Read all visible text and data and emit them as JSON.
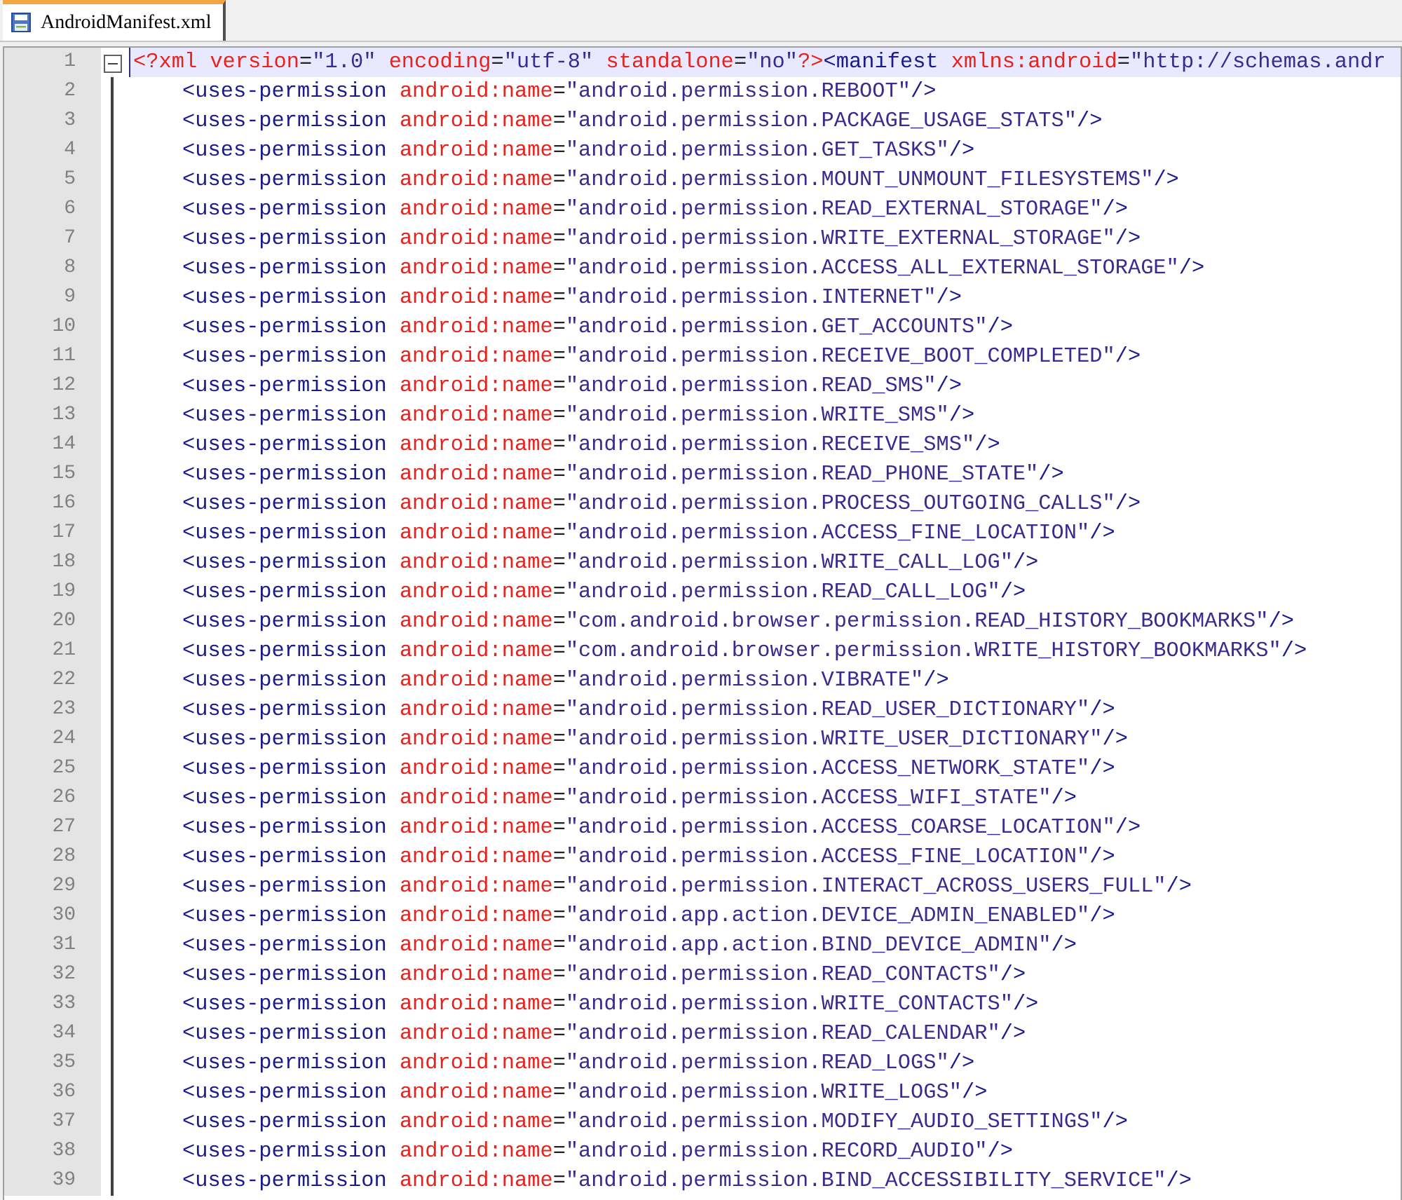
{
  "tabs": [
    {
      "label": "AndroidManifest.xml",
      "selected": true
    }
  ],
  "editor": {
    "root": {
      "number": "1",
      "current": true,
      "expanded": true,
      "tokens": [
        {
          "kind": "attr",
          "text": "<?xml"
        },
        {
          "kind": "attr",
          "text": " version"
        },
        {
          "kind": "punct",
          "text": "="
        },
        {
          "kind": "value",
          "text": "\"1.0\""
        },
        {
          "kind": "attr",
          "text": " encoding"
        },
        {
          "kind": "punct",
          "text": "="
        },
        {
          "kind": "value",
          "text": "\"utf-8\""
        },
        {
          "kind": "attr",
          "text": " standalone"
        },
        {
          "kind": "punct",
          "text": "="
        },
        {
          "kind": "value",
          "text": "\"no\""
        },
        {
          "kind": "attr",
          "text": "?>"
        },
        {
          "kind": "tag",
          "text": "<manifest"
        },
        {
          "kind": "attr",
          "text": " xmlns:android"
        },
        {
          "kind": "punct",
          "text": "="
        },
        {
          "kind": "value",
          "text": "\"http://schemas.andr"
        }
      ],
      "children": [
        {
          "number": "2",
          "current": false,
          "tokens": [
            {
              "kind": "tag",
              "text": "<uses-permission"
            },
            {
              "kind": "attr",
              "text": " android:name"
            },
            {
              "kind": "punct",
              "text": "="
            },
            {
              "kind": "value",
              "text": "\"android.permission.REBOOT\""
            },
            {
              "kind": "tag",
              "text": "/>"
            }
          ]
        },
        {
          "number": "3",
          "current": false,
          "tokens": [
            {
              "kind": "tag",
              "text": "<uses-permission"
            },
            {
              "kind": "attr",
              "text": " android:name"
            },
            {
              "kind": "punct",
              "text": "="
            },
            {
              "kind": "value",
              "text": "\"android.permission.PACKAGE_USAGE_STATS\""
            },
            {
              "kind": "tag",
              "text": "/>"
            }
          ]
        },
        {
          "number": "4",
          "current": false,
          "tokens": [
            {
              "kind": "tag",
              "text": "<uses-permission"
            },
            {
              "kind": "attr",
              "text": " android:name"
            },
            {
              "kind": "punct",
              "text": "="
            },
            {
              "kind": "value",
              "text": "\"android.permission.GET_TASKS\""
            },
            {
              "kind": "tag",
              "text": "/>"
            }
          ]
        },
        {
          "number": "5",
          "current": false,
          "tokens": [
            {
              "kind": "tag",
              "text": "<uses-permission"
            },
            {
              "kind": "attr",
              "text": " android:name"
            },
            {
              "kind": "punct",
              "text": "="
            },
            {
              "kind": "value",
              "text": "\"android.permission.MOUNT_UNMOUNT_FILESYSTEMS\""
            },
            {
              "kind": "tag",
              "text": "/>"
            }
          ]
        },
        {
          "number": "6",
          "current": false,
          "tokens": [
            {
              "kind": "tag",
              "text": "<uses-permission"
            },
            {
              "kind": "attr",
              "text": " android:name"
            },
            {
              "kind": "punct",
              "text": "="
            },
            {
              "kind": "value",
              "text": "\"android.permission.READ_EXTERNAL_STORAGE\""
            },
            {
              "kind": "tag",
              "text": "/>"
            }
          ]
        },
        {
          "number": "7",
          "current": false,
          "tokens": [
            {
              "kind": "tag",
              "text": "<uses-permission"
            },
            {
              "kind": "attr",
              "text": " android:name"
            },
            {
              "kind": "punct",
              "text": "="
            },
            {
              "kind": "value",
              "text": "\"android.permission.WRITE_EXTERNAL_STORAGE\""
            },
            {
              "kind": "tag",
              "text": "/>"
            }
          ]
        },
        {
          "number": "8",
          "current": false,
          "tokens": [
            {
              "kind": "tag",
              "text": "<uses-permission"
            },
            {
              "kind": "attr",
              "text": " android:name"
            },
            {
              "kind": "punct",
              "text": "="
            },
            {
              "kind": "value",
              "text": "\"android.permission.ACCESS_ALL_EXTERNAL_STORAGE\""
            },
            {
              "kind": "tag",
              "text": "/>"
            }
          ]
        },
        {
          "number": "9",
          "current": false,
          "tokens": [
            {
              "kind": "tag",
              "text": "<uses-permission"
            },
            {
              "kind": "attr",
              "text": " android:name"
            },
            {
              "kind": "punct",
              "text": "="
            },
            {
              "kind": "value",
              "text": "\"android.permission.INTERNET\""
            },
            {
              "kind": "tag",
              "text": "/>"
            }
          ]
        },
        {
          "number": "10",
          "current": false,
          "tokens": [
            {
              "kind": "tag",
              "text": "<uses-permission"
            },
            {
              "kind": "attr",
              "text": " android:name"
            },
            {
              "kind": "punct",
              "text": "="
            },
            {
              "kind": "value",
              "text": "\"android.permission.GET_ACCOUNTS\""
            },
            {
              "kind": "tag",
              "text": "/>"
            }
          ]
        },
        {
          "number": "11",
          "current": false,
          "tokens": [
            {
              "kind": "tag",
              "text": "<uses-permission"
            },
            {
              "kind": "attr",
              "text": " android:name"
            },
            {
              "kind": "punct",
              "text": "="
            },
            {
              "kind": "value",
              "text": "\"android.permission.RECEIVE_BOOT_COMPLETED\""
            },
            {
              "kind": "tag",
              "text": "/>"
            }
          ]
        },
        {
          "number": "12",
          "current": false,
          "tokens": [
            {
              "kind": "tag",
              "text": "<uses-permission"
            },
            {
              "kind": "attr",
              "text": " android:name"
            },
            {
              "kind": "punct",
              "text": "="
            },
            {
              "kind": "value",
              "text": "\"android.permission.READ_SMS\""
            },
            {
              "kind": "tag",
              "text": "/>"
            }
          ]
        },
        {
          "number": "13",
          "current": false,
          "tokens": [
            {
              "kind": "tag",
              "text": "<uses-permission"
            },
            {
              "kind": "attr",
              "text": " android:name"
            },
            {
              "kind": "punct",
              "text": "="
            },
            {
              "kind": "value",
              "text": "\"android.permission.WRITE_SMS\""
            },
            {
              "kind": "tag",
              "text": "/>"
            }
          ]
        },
        {
          "number": "14",
          "current": false,
          "tokens": [
            {
              "kind": "tag",
              "text": "<uses-permission"
            },
            {
              "kind": "attr",
              "text": " android:name"
            },
            {
              "kind": "punct",
              "text": "="
            },
            {
              "kind": "value",
              "text": "\"android.permission.RECEIVE_SMS\""
            },
            {
              "kind": "tag",
              "text": "/>"
            }
          ]
        },
        {
          "number": "15",
          "current": false,
          "tokens": [
            {
              "kind": "tag",
              "text": "<uses-permission"
            },
            {
              "kind": "attr",
              "text": " android:name"
            },
            {
              "kind": "punct",
              "text": "="
            },
            {
              "kind": "value",
              "text": "\"android.permission.READ_PHONE_STATE\""
            },
            {
              "kind": "tag",
              "text": "/>"
            }
          ]
        },
        {
          "number": "16",
          "current": false,
          "tokens": [
            {
              "kind": "tag",
              "text": "<uses-permission"
            },
            {
              "kind": "attr",
              "text": " android:name"
            },
            {
              "kind": "punct",
              "text": "="
            },
            {
              "kind": "value",
              "text": "\"android.permission.PROCESS_OUTGOING_CALLS\""
            },
            {
              "kind": "tag",
              "text": "/>"
            }
          ]
        },
        {
          "number": "17",
          "current": false,
          "tokens": [
            {
              "kind": "tag",
              "text": "<uses-permission"
            },
            {
              "kind": "attr",
              "text": " android:name"
            },
            {
              "kind": "punct",
              "text": "="
            },
            {
              "kind": "value",
              "text": "\"android.permission.ACCESS_FINE_LOCATION\""
            },
            {
              "kind": "tag",
              "text": "/>"
            }
          ]
        },
        {
          "number": "18",
          "current": false,
          "tokens": [
            {
              "kind": "tag",
              "text": "<uses-permission"
            },
            {
              "kind": "attr",
              "text": " android:name"
            },
            {
              "kind": "punct",
              "text": "="
            },
            {
              "kind": "value",
              "text": "\"android.permission.WRITE_CALL_LOG\""
            },
            {
              "kind": "tag",
              "text": "/>"
            }
          ]
        },
        {
          "number": "19",
          "current": false,
          "tokens": [
            {
              "kind": "tag",
              "text": "<uses-permission"
            },
            {
              "kind": "attr",
              "text": " android:name"
            },
            {
              "kind": "punct",
              "text": "="
            },
            {
              "kind": "value",
              "text": "\"android.permission.READ_CALL_LOG\""
            },
            {
              "kind": "tag",
              "text": "/>"
            }
          ]
        },
        {
          "number": "20",
          "current": false,
          "tokens": [
            {
              "kind": "tag",
              "text": "<uses-permission"
            },
            {
              "kind": "attr",
              "text": " android:name"
            },
            {
              "kind": "punct",
              "text": "="
            },
            {
              "kind": "value",
              "text": "\"com.android.browser.permission.READ_HISTORY_BOOKMARKS\""
            },
            {
              "kind": "tag",
              "text": "/>"
            }
          ]
        },
        {
          "number": "21",
          "current": false,
          "tokens": [
            {
              "kind": "tag",
              "text": "<uses-permission"
            },
            {
              "kind": "attr",
              "text": " android:name"
            },
            {
              "kind": "punct",
              "text": "="
            },
            {
              "kind": "value",
              "text": "\"com.android.browser.permission.WRITE_HISTORY_BOOKMARKS\""
            },
            {
              "kind": "tag",
              "text": "/>"
            }
          ]
        },
        {
          "number": "22",
          "current": false,
          "tokens": [
            {
              "kind": "tag",
              "text": "<uses-permission"
            },
            {
              "kind": "attr",
              "text": " android:name"
            },
            {
              "kind": "punct",
              "text": "="
            },
            {
              "kind": "value",
              "text": "\"android.permission.VIBRATE\""
            },
            {
              "kind": "tag",
              "text": "/>"
            }
          ]
        },
        {
          "number": "23",
          "current": false,
          "tokens": [
            {
              "kind": "tag",
              "text": "<uses-permission"
            },
            {
              "kind": "attr",
              "text": " android:name"
            },
            {
              "kind": "punct",
              "text": "="
            },
            {
              "kind": "value",
              "text": "\"android.permission.READ_USER_DICTIONARY\""
            },
            {
              "kind": "tag",
              "text": "/>"
            }
          ]
        },
        {
          "number": "24",
          "current": false,
          "tokens": [
            {
              "kind": "tag",
              "text": "<uses-permission"
            },
            {
              "kind": "attr",
              "text": " android:name"
            },
            {
              "kind": "punct",
              "text": "="
            },
            {
              "kind": "value",
              "text": "\"android.permission.WRITE_USER_DICTIONARY\""
            },
            {
              "kind": "tag",
              "text": "/>"
            }
          ]
        },
        {
          "number": "25",
          "current": false,
          "tokens": [
            {
              "kind": "tag",
              "text": "<uses-permission"
            },
            {
              "kind": "attr",
              "text": " android:name"
            },
            {
              "kind": "punct",
              "text": "="
            },
            {
              "kind": "value",
              "text": "\"android.permission.ACCESS_NETWORK_STATE\""
            },
            {
              "kind": "tag",
              "text": "/>"
            }
          ]
        },
        {
          "number": "26",
          "current": false,
          "tokens": [
            {
              "kind": "tag",
              "text": "<uses-permission"
            },
            {
              "kind": "attr",
              "text": " android:name"
            },
            {
              "kind": "punct",
              "text": "="
            },
            {
              "kind": "value",
              "text": "\"android.permission.ACCESS_WIFI_STATE\""
            },
            {
              "kind": "tag",
              "text": "/>"
            }
          ]
        },
        {
          "number": "27",
          "current": false,
          "tokens": [
            {
              "kind": "tag",
              "text": "<uses-permission"
            },
            {
              "kind": "attr",
              "text": " android:name"
            },
            {
              "kind": "punct",
              "text": "="
            },
            {
              "kind": "value",
              "text": "\"android.permission.ACCESS_COARSE_LOCATION\""
            },
            {
              "kind": "tag",
              "text": "/>"
            }
          ]
        },
        {
          "number": "28",
          "current": false,
          "tokens": [
            {
              "kind": "tag",
              "text": "<uses-permission"
            },
            {
              "kind": "attr",
              "text": " android:name"
            },
            {
              "kind": "punct",
              "text": "="
            },
            {
              "kind": "value",
              "text": "\"android.permission.ACCESS_FINE_LOCATION\""
            },
            {
              "kind": "tag",
              "text": "/>"
            }
          ]
        },
        {
          "number": "29",
          "current": false,
          "tokens": [
            {
              "kind": "tag",
              "text": "<uses-permission"
            },
            {
              "kind": "attr",
              "text": " android:name"
            },
            {
              "kind": "punct",
              "text": "="
            },
            {
              "kind": "value",
              "text": "\"android.permission.INTERACT_ACROSS_USERS_FULL\""
            },
            {
              "kind": "tag",
              "text": "/>"
            }
          ]
        },
        {
          "number": "30",
          "current": false,
          "tokens": [
            {
              "kind": "tag",
              "text": "<uses-permission"
            },
            {
              "kind": "attr",
              "text": " android:name"
            },
            {
              "kind": "punct",
              "text": "="
            },
            {
              "kind": "value",
              "text": "\"android.app.action.DEVICE_ADMIN_ENABLED\""
            },
            {
              "kind": "tag",
              "text": "/>"
            }
          ]
        },
        {
          "number": "31",
          "current": false,
          "tokens": [
            {
              "kind": "tag",
              "text": "<uses-permission"
            },
            {
              "kind": "attr",
              "text": " android:name"
            },
            {
              "kind": "punct",
              "text": "="
            },
            {
              "kind": "value",
              "text": "\"android.app.action.BIND_DEVICE_ADMIN\""
            },
            {
              "kind": "tag",
              "text": "/>"
            }
          ]
        },
        {
          "number": "32",
          "current": false,
          "tokens": [
            {
              "kind": "tag",
              "text": "<uses-permission"
            },
            {
              "kind": "attr",
              "text": " android:name"
            },
            {
              "kind": "punct",
              "text": "="
            },
            {
              "kind": "value",
              "text": "\"android.permission.READ_CONTACTS\""
            },
            {
              "kind": "tag",
              "text": "/>"
            }
          ]
        },
        {
          "number": "33",
          "current": false,
          "tokens": [
            {
              "kind": "tag",
              "text": "<uses-permission"
            },
            {
              "kind": "attr",
              "text": " android:name"
            },
            {
              "kind": "punct",
              "text": "="
            },
            {
              "kind": "value",
              "text": "\"android.permission.WRITE_CONTACTS\""
            },
            {
              "kind": "tag",
              "text": "/>"
            }
          ]
        },
        {
          "number": "34",
          "current": false,
          "tokens": [
            {
              "kind": "tag",
              "text": "<uses-permission"
            },
            {
              "kind": "attr",
              "text": " android:name"
            },
            {
              "kind": "punct",
              "text": "="
            },
            {
              "kind": "value",
              "text": "\"android.permission.READ_CALENDAR\""
            },
            {
              "kind": "tag",
              "text": "/>"
            }
          ]
        },
        {
          "number": "35",
          "current": false,
          "tokens": [
            {
              "kind": "tag",
              "text": "<uses-permission"
            },
            {
              "kind": "attr",
              "text": " android:name"
            },
            {
              "kind": "punct",
              "text": "="
            },
            {
              "kind": "value",
              "text": "\"android.permission.READ_LOGS\""
            },
            {
              "kind": "tag",
              "text": "/>"
            }
          ]
        },
        {
          "number": "36",
          "current": false,
          "tokens": [
            {
              "kind": "tag",
              "text": "<uses-permission"
            },
            {
              "kind": "attr",
              "text": " android:name"
            },
            {
              "kind": "punct",
              "text": "="
            },
            {
              "kind": "value",
              "text": "\"android.permission.WRITE_LOGS\""
            },
            {
              "kind": "tag",
              "text": "/>"
            }
          ]
        },
        {
          "number": "37",
          "current": false,
          "tokens": [
            {
              "kind": "tag",
              "text": "<uses-permission"
            },
            {
              "kind": "attr",
              "text": " android:name"
            },
            {
              "kind": "punct",
              "text": "="
            },
            {
              "kind": "value",
              "text": "\"android.permission.MODIFY_AUDIO_SETTINGS\""
            },
            {
              "kind": "tag",
              "text": "/>"
            }
          ]
        },
        {
          "number": "38",
          "current": false,
          "tokens": [
            {
              "kind": "tag",
              "text": "<uses-permission"
            },
            {
              "kind": "attr",
              "text": " android:name"
            },
            {
              "kind": "punct",
              "text": "="
            },
            {
              "kind": "value",
              "text": "\"android.permission.RECORD_AUDIO\""
            },
            {
              "kind": "tag",
              "text": "/>"
            }
          ]
        },
        {
          "number": "39",
          "current": false,
          "tokens": [
            {
              "kind": "tag",
              "text": "<uses-permission"
            },
            {
              "kind": "attr",
              "text": " android:name"
            },
            {
              "kind": "punct",
              "text": "="
            },
            {
              "kind": "value",
              "text": "\"android.permission.BIND_ACCESSIBILITY_SERVICE\""
            },
            {
              "kind": "tag",
              "text": "/>"
            }
          ]
        }
      ]
    }
  }
}
